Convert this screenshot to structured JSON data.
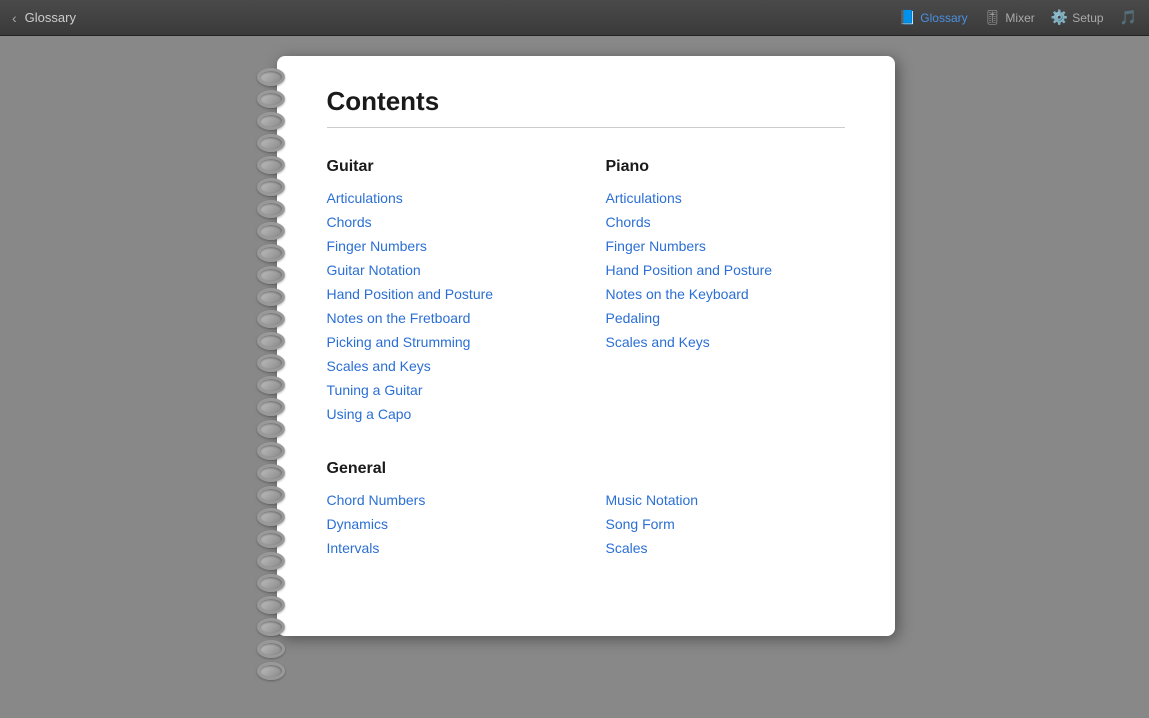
{
  "titlebar": {
    "back_arrow": "‹",
    "title": "Glossary",
    "nav_items": [
      {
        "id": "glossary",
        "label": "Glossary",
        "icon": "📘",
        "active": true
      },
      {
        "id": "mixer",
        "label": "Mixer",
        "icon": "🎚",
        "active": false
      },
      {
        "id": "setup",
        "label": "Setup",
        "icon": "⚙️",
        "active": false
      },
      {
        "id": "music",
        "label": "",
        "icon": "🎵",
        "active": false
      }
    ]
  },
  "page": {
    "title": "Contents",
    "sections": [
      {
        "id": "guitar",
        "heading": "Guitar",
        "links": [
          "Articulations",
          "Chords",
          "Finger Numbers",
          "Guitar Notation",
          "Hand Position and Posture",
          "Notes on the Fretboard",
          "Picking and Strumming",
          "Scales and Keys",
          "Tuning a Guitar",
          "Using a Capo"
        ]
      },
      {
        "id": "piano",
        "heading": "Piano",
        "links": [
          "Articulations",
          "Chords",
          "Finger Numbers",
          "Hand Position and Posture",
          "Notes on the Keyboard",
          "Pedaling",
          "Scales and Keys"
        ]
      }
    ],
    "general_section": {
      "heading": "General",
      "columns": [
        [
          "Chord Numbers",
          "Dynamics",
          "Intervals"
        ],
        [
          "Music Notation",
          "Song Form",
          "Scales"
        ]
      ]
    }
  },
  "rings_count": 28
}
